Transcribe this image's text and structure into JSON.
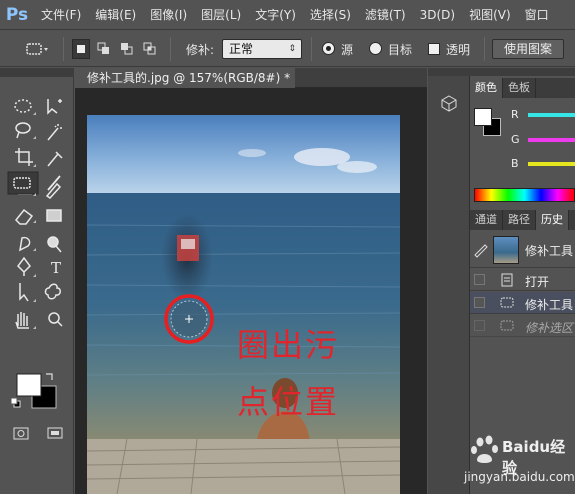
{
  "app": {
    "logo": "Ps"
  },
  "menu": [
    "文件(F)",
    "编辑(E)",
    "图像(I)",
    "图层(L)",
    "文字(Y)",
    "选择(S)",
    "滤镜(T)",
    "3D(D)",
    "视图(V)",
    "窗口"
  ],
  "options": {
    "patch_label": "修补:",
    "patch_mode": "正常",
    "source_label": "源",
    "source_selected": true,
    "target_label": "目标",
    "transparent_label": "透明",
    "use_pattern_label": "使用图案"
  },
  "document": {
    "tab_title": "修补工具的.jpg @ 157%(RGB/8#) *",
    "close_glyph": "×"
  },
  "annotation": {
    "line1": "圈出污",
    "line2": "点位置",
    "color": "#e0262c"
  },
  "color_panel": {
    "tabs": [
      "颜色",
      "色板"
    ],
    "channels": [
      "R",
      "G",
      "B"
    ],
    "channel_colors": [
      "#36e5e5",
      "#ee3bee",
      "#e6e61e"
    ]
  },
  "history_panel": {
    "tabs": [
      "通道",
      "路径",
      "历史"
    ],
    "snapshot_label": "修补工具",
    "items": [
      {
        "label": "打开",
        "selected": false
      },
      {
        "label": "修补工具",
        "selected": true
      },
      {
        "label": "修补选区",
        "selected": false,
        "dimmed": true
      }
    ]
  },
  "watermark": {
    "brand": "Baidu经验",
    "url": "jingyan.baidu.com"
  }
}
